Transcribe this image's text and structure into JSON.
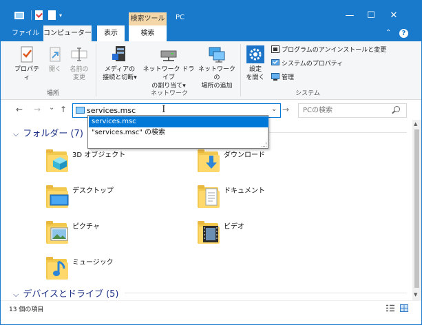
{
  "titlebar": {
    "contextual_tab": "検索ツール",
    "title": "PC",
    "minimize": "—",
    "maximize": "☐",
    "close": "✕",
    "qat_dropdown": "▾"
  },
  "ribbon_tabs": {
    "file": "ファイル",
    "computer": "コンピューター",
    "view": "表示",
    "manage": "検索",
    "collapse": "⌃",
    "help": "?"
  },
  "ribbon": {
    "location": {
      "properties": "プロパティ",
      "open": "開く",
      "rename_1": "名前の",
      "rename_2": "変更",
      "group": "場所"
    },
    "network": {
      "media_1": "メディアの",
      "media_2": "接続と切断▾",
      "map_1": "ネットワーク ドライブ",
      "map_2": "の割り当て▾",
      "add_1": "ネットワークの",
      "add_2": "場所の追加",
      "group": "ネットワーク"
    },
    "system": {
      "settings_1": "設定",
      "settings_2": "を開く",
      "uninstall": "プログラムのアンインストールと変更",
      "sysprops": "システムのプロパティ",
      "manage": "管理",
      "group": "システム"
    }
  },
  "nav": {
    "back": "←",
    "forward": "→",
    "recent": "⌄",
    "up": "↑",
    "address_value": "services.msc",
    "address_dropdown": "⌄",
    "go": "→",
    "search_placeholder": "PCの検索",
    "ibeam": "I"
  },
  "autocomplete": {
    "items": [
      "services.msc",
      "\"services.msc\" の検索"
    ]
  },
  "content": {
    "folders_header": "フォルダー (7)",
    "devices_header": "デバイスとドライブ (5)",
    "chevron": "⌵",
    "folders": [
      "3D オブジェクト",
      "ダウンロード",
      "デスクトップ",
      "ドキュメント",
      "ピクチャ",
      "ビデオ",
      "ミュージック"
    ]
  },
  "scrollbar": {
    "up": "▲",
    "down": "▼"
  },
  "status": {
    "count": "13 個の項目"
  },
  "colors": {
    "accent": "#1979ca",
    "selection": "#0078d7",
    "header_text": "#1e3287",
    "folder": "#ffd86b"
  }
}
